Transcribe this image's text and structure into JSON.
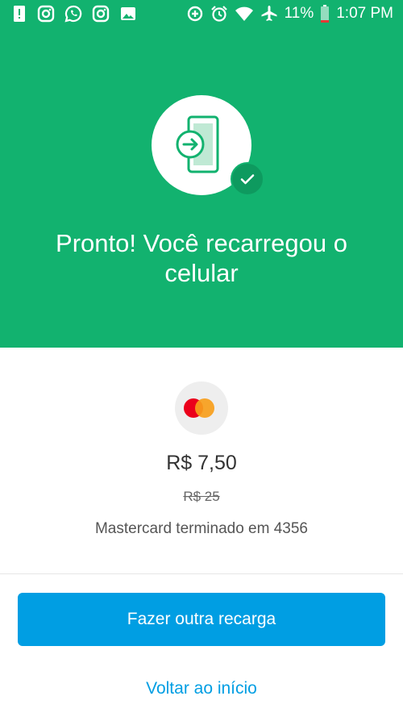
{
  "status_bar": {
    "battery": "11%",
    "time": "1:07 PM",
    "left_icons": [
      "alert-icon",
      "instagram-icon",
      "whatsapp-icon",
      "instagram-icon",
      "image-icon"
    ],
    "right_icons": [
      "data-saver-icon",
      "alarm-icon",
      "wifi-icon",
      "airplane-icon",
      "battery-icon"
    ]
  },
  "colors": {
    "hero_bg": "#12b26f",
    "badge": "#0e9a5f",
    "primary": "#009ee3",
    "mastercard_red": "#eb001b",
    "mastercard_orange": "#f79e1b"
  },
  "hero": {
    "icon": "phone-recharge-icon",
    "badge_icon": "check-icon",
    "title_line1": "Pronto! Você recarregou o",
    "title_line2": "celular"
  },
  "payment": {
    "card_icon": "mastercard-icon",
    "amount": "R$ 7,50",
    "original_amount": "R$ 25",
    "card_description": "Mastercard terminado em 4356"
  },
  "actions": {
    "primary_label": "Fazer outra recarga",
    "secondary_label": "Voltar ao início"
  }
}
